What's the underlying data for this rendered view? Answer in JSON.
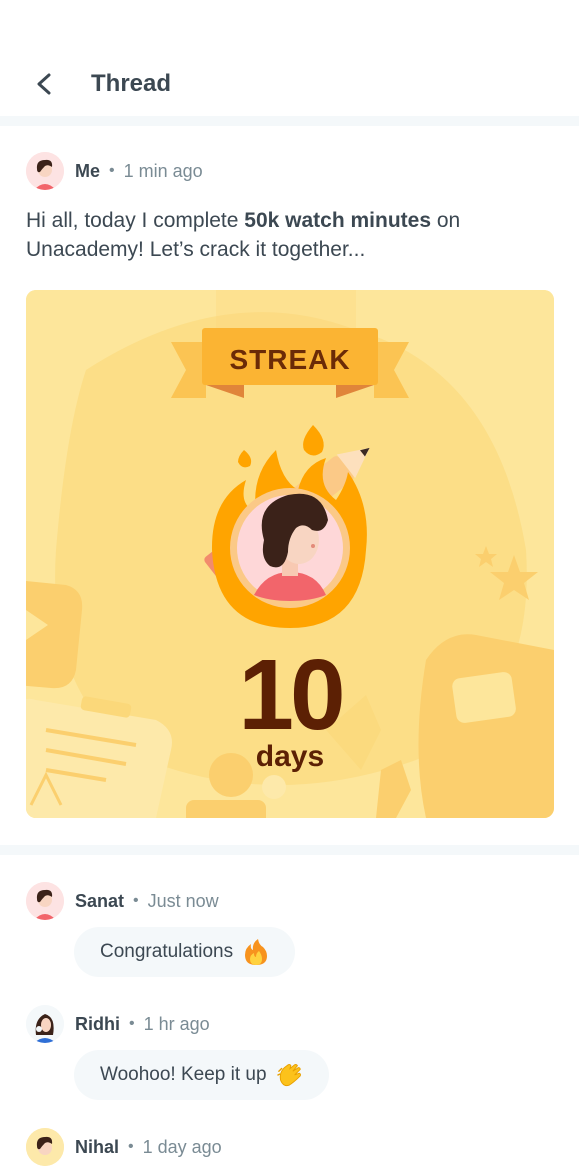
{
  "header": {
    "title": "Thread",
    "back_icon": "chevron-left-icon"
  },
  "post": {
    "author": "Me",
    "time": "1 min ago",
    "text_before": "Hi all, today I complete ",
    "text_bold": "50k watch minutes",
    "text_after": " on Unacademy! Let’s crack it together...",
    "card": {
      "badge": "STREAK",
      "number": "10",
      "unit": "days",
      "colors": {
        "background": "#fde69b",
        "ribbon": "#fbb433",
        "flame": "#ffa400",
        "text": "#5c2004"
      }
    }
  },
  "comments": [
    {
      "author": "Sanat",
      "time": "Just now",
      "text": "Congratulations",
      "emoji": "fire-emoji-icon"
    },
    {
      "author": "Ridhi",
      "time": "1 hr ago",
      "text": "Woohoo! Keep it up",
      "emoji": "clapping-hands-emoji-icon"
    },
    {
      "author": "Nihal",
      "time": "1 day ago"
    }
  ]
}
